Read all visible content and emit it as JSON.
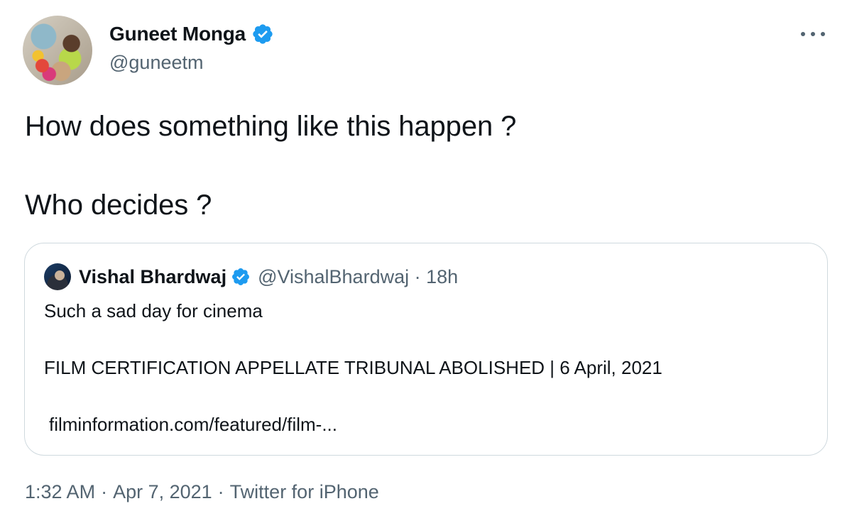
{
  "author": {
    "display_name": "Guneet Monga",
    "handle": "@guneetm",
    "verified_icon": "verified-badge-icon"
  },
  "tweet": {
    "line1": "How does something like this happen ?",
    "line2": "Who decides ?"
  },
  "quoted": {
    "display_name": "Vishal Bhardwaj",
    "meta": "@VishalBhardwaj · 18h",
    "text1": "Such a sad day for cinema",
    "text2": "FILM CERTIFICATION APPELLATE TRIBUNAL ABOLISHED | 6 April, 2021",
    "link": "filminformation.com/featured/film-..."
  },
  "footer": {
    "time": "1:32 AM",
    "sep1": "·",
    "date": "Apr 7, 2021",
    "sep2": "·",
    "source": "Twitter for iPhone"
  },
  "colors": {
    "verified": "#1d9bf0",
    "secondary_text": "#536471",
    "border": "#cfd9de"
  }
}
